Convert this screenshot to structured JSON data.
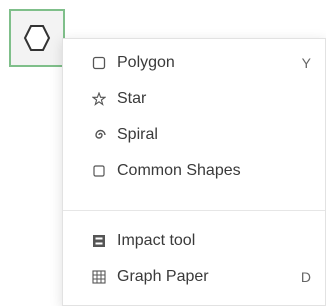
{
  "tool": {
    "icon": "hexagon-icon",
    "active_color": "#7fbf8a"
  },
  "menu": {
    "shape_items": [
      {
        "label": "Polygon",
        "icon": "polygon-icon",
        "shortcut": "Y"
      },
      {
        "label": "Star",
        "icon": "star-icon"
      },
      {
        "label": "Spiral",
        "icon": "spiral-icon"
      },
      {
        "label": "Common Shapes",
        "icon": "shape-icon"
      }
    ],
    "tool_items": [
      {
        "label": "Impact tool",
        "icon": "impact-tool-icon"
      },
      {
        "label": "Graph Paper",
        "icon": "grid-icon",
        "shortcut": "D"
      }
    ]
  }
}
